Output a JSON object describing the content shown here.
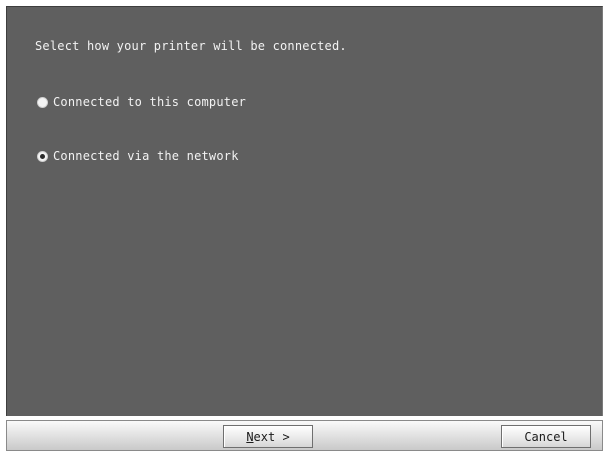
{
  "prompt": "Select how your printer will be connected.",
  "options": [
    {
      "label": "Connected to this computer",
      "selected": false
    },
    {
      "label": "Connected via the network",
      "selected": true
    }
  ],
  "buttons": {
    "next_mnemonic": "N",
    "next_rest": "ext >",
    "cancel": "Cancel"
  },
  "colors": {
    "panel_background": "#5f5f5f",
    "text": "#f2f2f2",
    "button_bar": "#e4e4e4"
  }
}
